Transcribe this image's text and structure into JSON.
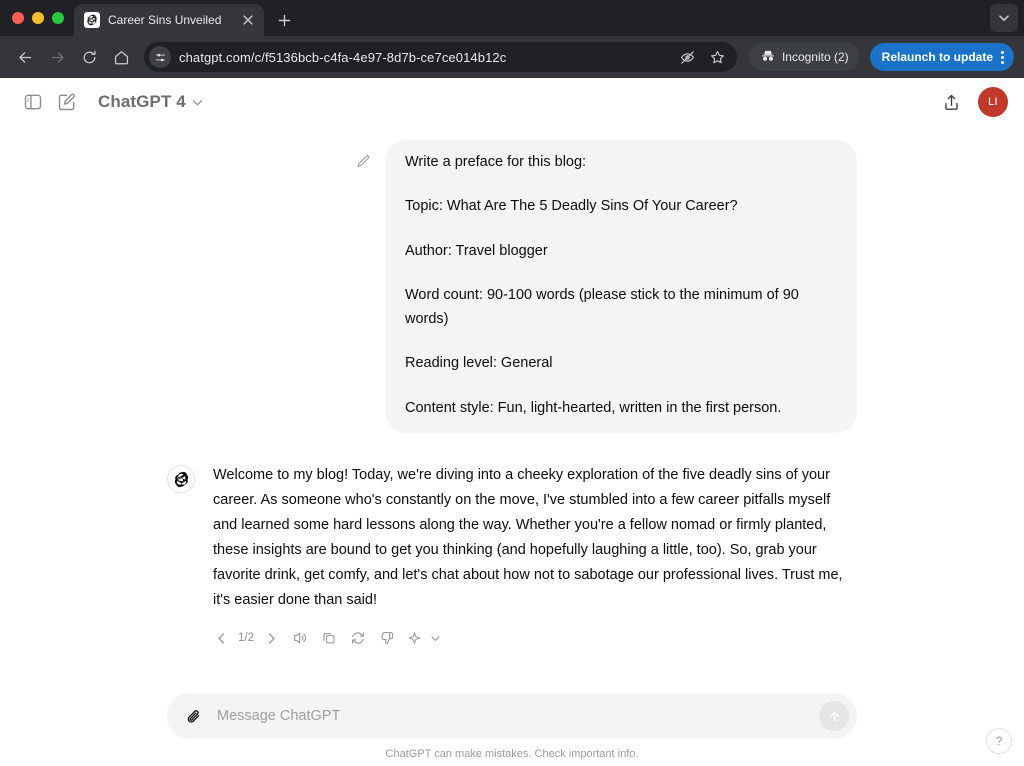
{
  "browser": {
    "tab": {
      "title": "Career Sins Unveiled",
      "favicon": "openai-logo-icon",
      "close": "✕"
    },
    "new_tab_label": "+",
    "tab_search": "chevron-down-icon",
    "nav": {
      "back": "←",
      "forward": "→",
      "reload": "⟳",
      "home": "⌂"
    },
    "omnibox": {
      "site_settings_icon": "tune-icon",
      "url": "chatgpt.com/c/f5136bcb-c4fa-4e97-8d7b-ce7ce014b12c",
      "view_site_info_icon": "eye-off-icon",
      "bookmark_icon": "star-icon"
    },
    "incognito": {
      "label": "Incognito (2)",
      "icon": "incognito-hat-icon"
    },
    "relaunch": {
      "label": "Relaunch to update",
      "color": "#1a73c8",
      "menu_icon": "kebab-icon"
    }
  },
  "app_header": {
    "sidebar_toggle_icon": "panel-left-icon",
    "new_chat_icon": "pencil-square-icon",
    "model": "ChatGPT 4",
    "model_caret": "chevron-down-icon",
    "share_icon": "share-upload-icon",
    "avatar_initials": "LI",
    "avatar_color": "#c0392b"
  },
  "conversation": {
    "user_message": {
      "edit_icon": "pencil-icon",
      "paragraphs": [
        "Write a preface for this blog:",
        "Topic: What Are The 5 Deadly Sins Of Your Career?",
        "Author: Travel blogger",
        "Word count: 90-100 words (please stick to the minimum of 90 words)",
        "Reading level: General",
        "Content style: Fun, light-hearted, written in the first person."
      ]
    },
    "assistant_message": {
      "avatar_icon": "openai-logo-icon",
      "text": "Welcome to my blog! Today, we're diving into a cheeky exploration of the five deadly sins of your career. As someone who's constantly on the move, I've stumbled into a few career pitfalls myself and learned some hard lessons along the way. Whether you're a fellow nomad or firmly planted, these insights are bound to get you thinking (and hopefully laughing a little, too). So, grab your favorite drink, get comfy, and let's chat about how not to sabotage our professional lives. Trust me, it's easier done than said!",
      "actions": {
        "prev": "chevron-left-icon",
        "pager": "1/2",
        "next": "chevron-right-icon",
        "read_aloud": "speaker-icon",
        "copy": "copy-icon",
        "regenerate": "refresh-icon",
        "dislike": "thumbs-down-icon",
        "model_switch": "sparkle-icon",
        "model_switch_caret": "chevron-down-icon"
      }
    }
  },
  "composer": {
    "attach_icon": "paperclip-icon",
    "placeholder": "Message ChatGPT",
    "send_icon": "arrow-up-icon"
  },
  "footer": {
    "disclaimer": "ChatGPT can make mistakes. Check important info.",
    "help": "?"
  }
}
